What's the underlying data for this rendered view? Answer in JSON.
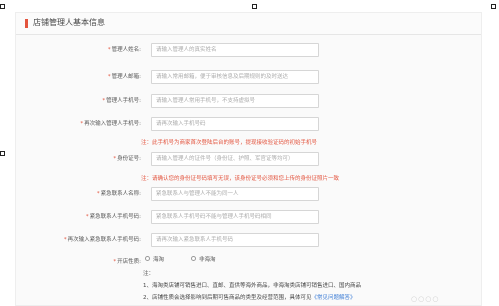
{
  "section": {
    "title": "店铺管理人基本信息"
  },
  "fields": {
    "name": {
      "label": "管理人姓名:",
      "placeholder": "请输入管理人的真实姓名"
    },
    "email": {
      "label": "管理人邮箱:",
      "placeholder": "请输入常用邮箱，便于审核信息及后期规则的及时送达"
    },
    "phone": {
      "label": "管理人手机号:",
      "placeholder": "请输入管理人常用手机号，不支持虚拟号"
    },
    "phone2": {
      "label": "再次输入管理人手机号:",
      "placeholder": "请再次输入手机号码"
    },
    "phone_hint": "注：此手机号为商家首次登陆后台的账号，提现接收验证码的初始手机号",
    "idcard": {
      "label": "身份证号:",
      "placeholder": "请输入管理人的证件号（身份证、护照、军官证等均可）"
    },
    "idcard_hint": "注：请确认您的身份证号码填写无误，该身份证号必须和您上传的身份证照片一致",
    "ec_name": {
      "label": "紧急联系人名称:",
      "placeholder": "紧急联系人与管理人不能为同一人"
    },
    "ec_phone": {
      "label": "紧急联系人手机号码:",
      "placeholder": "紧急联系人手机号码不能与管理人手机号码相同"
    },
    "ec_phone2": {
      "label": "再次输入紧急联系人手机号码:",
      "placeholder": "请再次输入紧急联系人手机号码"
    },
    "bond": {
      "label": "开店性质:",
      "option1": "海淘",
      "option2": "非海淘"
    }
  },
  "notes": {
    "title": "注：",
    "line1": "1、海淘类店铺可销售进口、直邮、直供等海外商品，非海淘类店铺可销售进口、国内商品",
    "line2_prefix": "2、店铺性质会选择影响到后期可售商品的类型及经营范围，具体可见",
    "line2_link": "《常见问题解答》"
  },
  "colors": {
    "accent": "#e3543e",
    "link": "#3a7bd5"
  },
  "icons": {
    "required": "asterisk",
    "watermark": "dots-watermark"
  }
}
